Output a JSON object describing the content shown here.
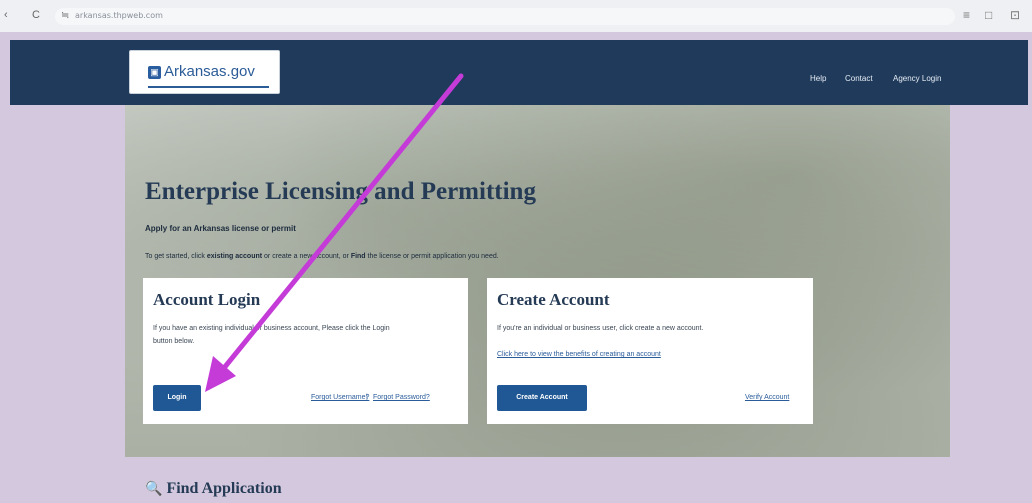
{
  "browser": {
    "url": "arkansas.thpweb.com",
    "back_glyph": "‹",
    "reload_glyph": "C",
    "site_glyph": "≒",
    "right_icons": [
      "≡",
      "□",
      "⊡"
    ]
  },
  "header": {
    "logo_text": "Arkansas.gov",
    "logo_glyph": "▣",
    "links": [
      "Help",
      "Contact",
      "Agency Login"
    ]
  },
  "hero": {
    "title": "Enterprise Licensing and Permitting",
    "subtitle": "Apply for an Arkansas license or permit",
    "desc_1": "To get started, click ",
    "desc_b1": "existing account",
    "desc_2": " or create a new account, or ",
    "desc_b2": "Find",
    "desc_3": " the license or permit application you need."
  },
  "login_card": {
    "title": "Account Login",
    "text_1": "If you have an existing individual or business account, Please click the Login",
    "text_2": "button below.",
    "button": "Login",
    "forgot_username": "Forgot Username?",
    "separator": "|",
    "forgot_password": "Forgot Password?"
  },
  "create_card": {
    "title": "Create Account",
    "text": "If you're an individual or business user, click create a new account.",
    "benefits_link": "Click here to view the benefits of creating an account",
    "button": "Create Account",
    "verify_link": "Verify Account"
  },
  "find": {
    "glyph": "🔍",
    "title": "Find Application"
  },
  "colors": {
    "header": "#1f3a5b",
    "button": "#1f5895",
    "annotation_arrow": "#c43bd8",
    "frame": "#d4c8de"
  }
}
